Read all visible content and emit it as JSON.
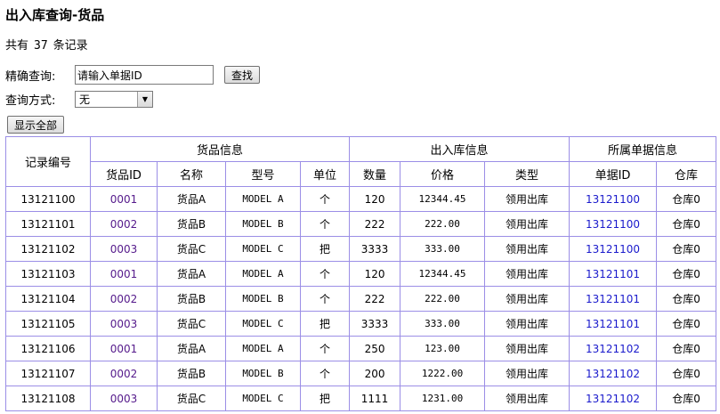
{
  "page_title": "出入库查询-货品",
  "record_count": {
    "prefix": "共有",
    "count": "37",
    "suffix": "条记录"
  },
  "search": {
    "label": "精确查询:",
    "input_value": "请输入单据ID",
    "button": "查找"
  },
  "query_mode": {
    "label": "查询方式:",
    "selected": "无"
  },
  "show_all_button": "显示全部",
  "table": {
    "group_headers": {
      "record_no": "记录编号",
      "goods_info": "货品信息",
      "io_info": "出入库信息",
      "doc_info": "所属单据信息"
    },
    "columns": {
      "goods_id": "货品ID",
      "name": "名称",
      "model": "型号",
      "unit": "单位",
      "qty": "数量",
      "price": "价格",
      "type": "类型",
      "doc_id": "单据ID",
      "warehouse": "仓库"
    },
    "rows": [
      {
        "record": "13121100",
        "goods_id": "0001",
        "name": "货品A",
        "model": "MODEL A",
        "unit": "个",
        "qty": "120",
        "price": "12344.45",
        "type": "领用出库",
        "doc_id": "13121100",
        "warehouse": "仓库0"
      },
      {
        "record": "13121101",
        "goods_id": "0002",
        "name": "货品B",
        "model": "MODEL B",
        "unit": "个",
        "qty": "222",
        "price": "222.00",
        "type": "领用出库",
        "doc_id": "13121100",
        "warehouse": "仓库0"
      },
      {
        "record": "13121102",
        "goods_id": "0003",
        "name": "货品C",
        "model": "MODEL C",
        "unit": "把",
        "qty": "3333",
        "price": "333.00",
        "type": "领用出库",
        "doc_id": "13121100",
        "warehouse": "仓库0"
      },
      {
        "record": "13121103",
        "goods_id": "0001",
        "name": "货品A",
        "model": "MODEL A",
        "unit": "个",
        "qty": "120",
        "price": "12344.45",
        "type": "领用出库",
        "doc_id": "13121101",
        "warehouse": "仓库0"
      },
      {
        "record": "13121104",
        "goods_id": "0002",
        "name": "货品B",
        "model": "MODEL B",
        "unit": "个",
        "qty": "222",
        "price": "222.00",
        "type": "领用出库",
        "doc_id": "13121101",
        "warehouse": "仓库0"
      },
      {
        "record": "13121105",
        "goods_id": "0003",
        "name": "货品C",
        "model": "MODEL C",
        "unit": "把",
        "qty": "3333",
        "price": "333.00",
        "type": "领用出库",
        "doc_id": "13121101",
        "warehouse": "仓库0"
      },
      {
        "record": "13121106",
        "goods_id": "0001",
        "name": "货品A",
        "model": "MODEL A",
        "unit": "个",
        "qty": "250",
        "price": "123.00",
        "type": "领用出库",
        "doc_id": "13121102",
        "warehouse": "仓库0"
      },
      {
        "record": "13121107",
        "goods_id": "0002",
        "name": "货品B",
        "model": "MODEL B",
        "unit": "个",
        "qty": "200",
        "price": "1222.00",
        "type": "领用出库",
        "doc_id": "13121102",
        "warehouse": "仓库0"
      },
      {
        "record": "13121108",
        "goods_id": "0003",
        "name": "货品C",
        "model": "MODEL C",
        "unit": "把",
        "qty": "1111",
        "price": "1231.00",
        "type": "领用出库",
        "doc_id": "13121102",
        "warehouse": "仓库0"
      }
    ]
  }
}
